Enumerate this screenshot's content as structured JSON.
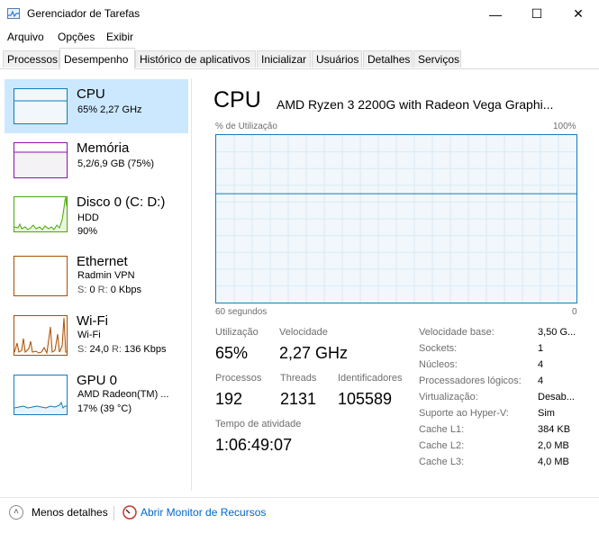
{
  "window": {
    "title": "Gerenciador de Tarefas",
    "minimize_icon": "—",
    "maximize_icon": "☐",
    "close_icon": "✕"
  },
  "menu": [
    "Arquivo",
    "Opções",
    "Exibir"
  ],
  "tabs": [
    {
      "label": "Processos",
      "active": false
    },
    {
      "label": "Desempenho",
      "active": true
    },
    {
      "label": "Histórico de aplicativos",
      "active": false
    },
    {
      "label": "Inicializar",
      "active": false
    },
    {
      "label": "Usuários",
      "active": false
    },
    {
      "label": "Detalhes",
      "active": false
    },
    {
      "label": "Serviços",
      "active": false
    }
  ],
  "sidebar": {
    "items": [
      {
        "title": "CPU",
        "line1": "65% 2,27 GHz",
        "color": "#117dbb",
        "selected": true
      },
      {
        "title": "Memória",
        "line1": "5,2/6,9 GB (75%)",
        "color": "#8b12ae"
      },
      {
        "title": "Disco 0 (C: D:)",
        "line1": "HDD",
        "line2": "90%",
        "color": "#4da60c"
      },
      {
        "title": "Ethernet",
        "line1": "Radmin VPN",
        "line2_s_label": "S:",
        "line2_s_value": "0",
        "line2_r_label": "R:",
        "line2_r_value": "0 Kbps",
        "color": "#a74f01"
      },
      {
        "title": "Wi-Fi",
        "line1": "Wi-Fi",
        "line2_s_label": "S:",
        "line2_s_value": "24,0",
        "line2_r_label": "R:",
        "line2_r_value": "136 Kbps",
        "color": "#a74f01"
      },
      {
        "title": "GPU 0",
        "line1": "AMD Radeon(TM) ...",
        "line2": "17% (39 °C)",
        "color": "#117dbb"
      }
    ]
  },
  "main": {
    "title": "CPU",
    "model": "AMD Ryzen 3 2200G with Radeon Vega Graphi...",
    "graph": {
      "ylabel": "% de Utilização",
      "ymax_label": "100%",
      "xlabel_left": "60 segundos",
      "xlabel_right": "0",
      "current_utilization_fraction": 0.65
    },
    "stats": {
      "utilizacao_label": "Utilização",
      "utilizacao_value": "65%",
      "velocidade_label": "Velocidade",
      "velocidade_value": "2,27 GHz",
      "processos_label": "Processos",
      "processos_value": "192",
      "threads_label": "Threads",
      "threads_value": "2131",
      "identificadores_label": "Identificadores",
      "identificadores_value": "105589",
      "tempo_label": "Tempo de atividade",
      "tempo_value": "1:06:49:07"
    },
    "details": [
      {
        "key": "Velocidade base:",
        "value": "3,50 G..."
      },
      {
        "key": "Sockets:",
        "value": "1"
      },
      {
        "key": "Núcleos:",
        "value": "4"
      },
      {
        "key": "Processadores lógicos:",
        "value": "4"
      },
      {
        "key": "Virtualização:",
        "value": "Desab..."
      },
      {
        "key": "Suporte ao Hyper-V:",
        "value": "Sim"
      },
      {
        "key": "Cache L1:",
        "value": "384 KB"
      },
      {
        "key": "Cache L2:",
        "value": "2,0 MB"
      },
      {
        "key": "Cache L3:",
        "value": "4,0 MB"
      }
    ]
  },
  "footer": {
    "less_details": "Menos detalhes",
    "monitor_link": "Abrir Monitor de Recursos"
  }
}
